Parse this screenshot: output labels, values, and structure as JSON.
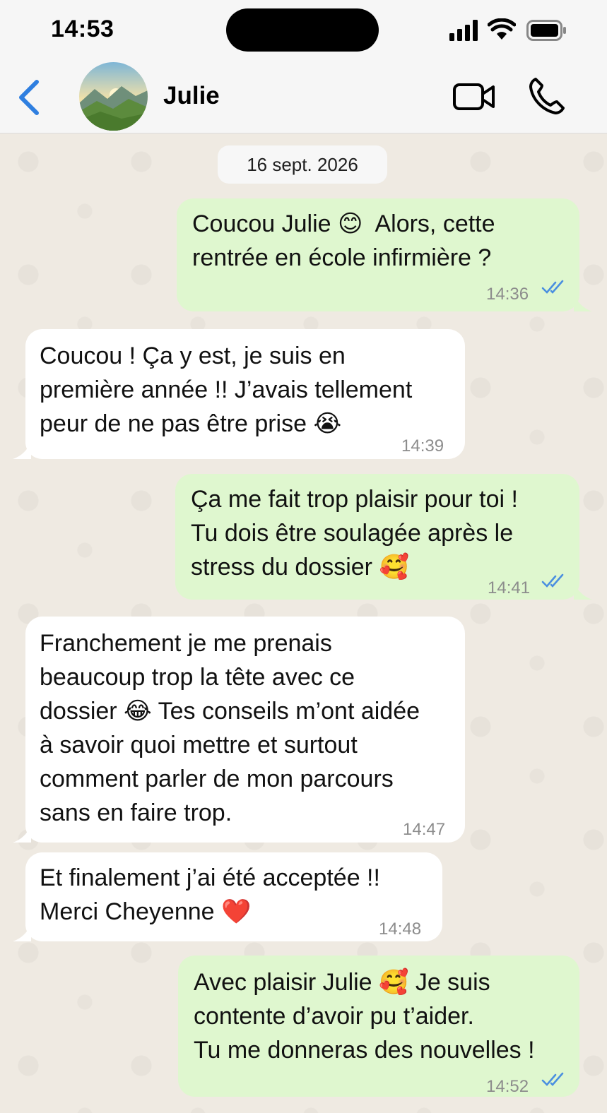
{
  "status": {
    "time": "14:53"
  },
  "header": {
    "contact_name": "Julie"
  },
  "chat": {
    "date": "16 sept. 2026",
    "messages": [
      {
        "dir": "out",
        "lines": [
          "Coucou Julie 😊  Alors, cette",
          "rentrée en école infirmière ?"
        ],
        "time": "14:36",
        "read": true
      },
      {
        "dir": "in",
        "lines": [
          "Coucou ! Ça y est, je suis en",
          "première année !! J’avais tellement",
          "peur de ne pas être prise 😭"
        ],
        "time": "14:39"
      },
      {
        "dir": "out",
        "lines": [
          "Ça me fait trop plaisir pour toi !",
          "Tu dois être soulagée après le",
          "stress du dossier 🥰"
        ],
        "time": "14:41",
        "read": true
      },
      {
        "dir": "in",
        "lines": [
          "Franchement je me prenais",
          "beaucoup trop la tête avec ce",
          "dossier 😂 Tes conseils m’ont aidée",
          "à savoir quoi mettre et surtout",
          "comment parler de mon parcours",
          "sans en faire trop."
        ],
        "time": "14:47"
      },
      {
        "dir": "in",
        "lines": [
          "Et finalement j’ai été acceptée !!",
          "Merci Cheyenne ❤️"
        ],
        "time": "14:48"
      },
      {
        "dir": "out",
        "lines": [
          "Avec plaisir Julie 🥰 Je suis",
          "contente d’avoir pu t’aider.",
          "Tu me donneras des nouvelles !"
        ],
        "time": "14:52",
        "read": true
      }
    ]
  },
  "colors": {
    "accent_blue": "#2f7fe0",
    "outgoing_bubble": "#dff7cf",
    "incoming_bubble": "#ffffff",
    "read_ticks": "#4a8fe0"
  },
  "icons": {
    "back": "chevron-left-icon",
    "video": "video-camera-icon",
    "call": "phone-icon",
    "signal": "cellular-signal-icon",
    "wifi": "wifi-icon",
    "battery": "battery-icon",
    "read": "double-check-icon"
  }
}
